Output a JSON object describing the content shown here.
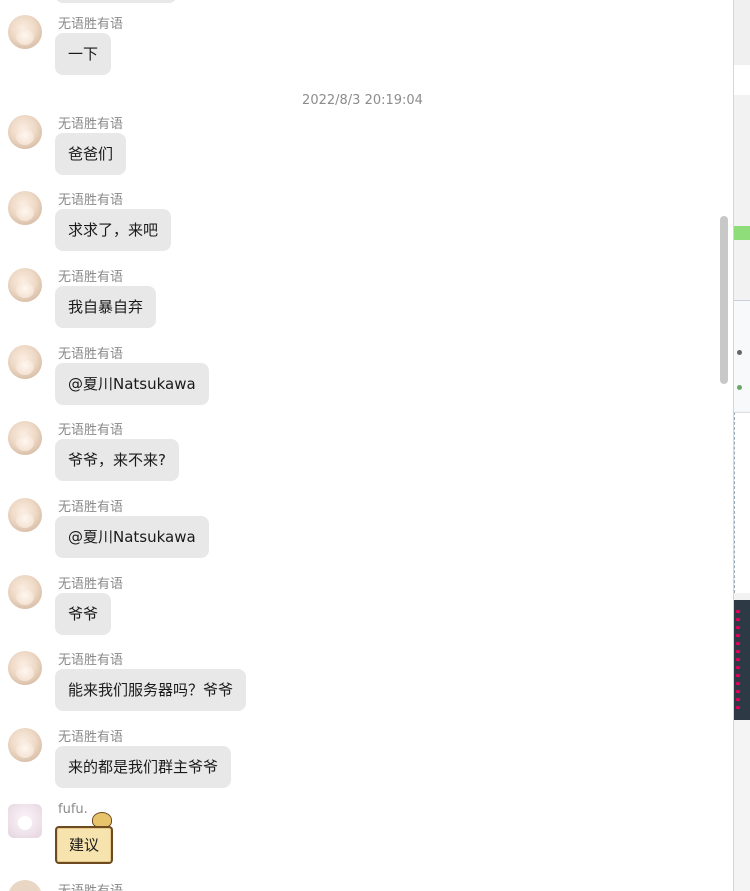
{
  "timestamp": "2022/8/3 20:19:04",
  "messages": [
    {
      "sender": "无语胜有语",
      "text": "一下"
    },
    {
      "sender": "无语胜有语",
      "text": "爸爸们"
    },
    {
      "sender": "无语胜有语",
      "text": "求求了，来吧"
    },
    {
      "sender": "无语胜有语",
      "text": "我自暴自弃"
    },
    {
      "sender": "无语胜有语",
      "text": "@夏川Natsukawa"
    },
    {
      "sender": "无语胜有语",
      "text": "爷爷，来不来?"
    },
    {
      "sender": "无语胜有语",
      "text": "@夏川Natsukawa"
    },
    {
      "sender": "无语胜有语",
      "text": "爷爷"
    },
    {
      "sender": "无语胜有语",
      "text": "能来我们服务器吗？爷爷"
    },
    {
      "sender": "无语胜有语",
      "text": "来的都是我们群主爷爷"
    },
    {
      "sender": "fufu.",
      "text": "建议"
    }
  ],
  "partial_bottom_sender": "无语胜有语",
  "colors": {
    "bubble": "#e8e8e8",
    "name": "#8a8a8a",
    "timestamp": "#8c8c8c",
    "scroll_bubble": "#f6e3ae"
  }
}
